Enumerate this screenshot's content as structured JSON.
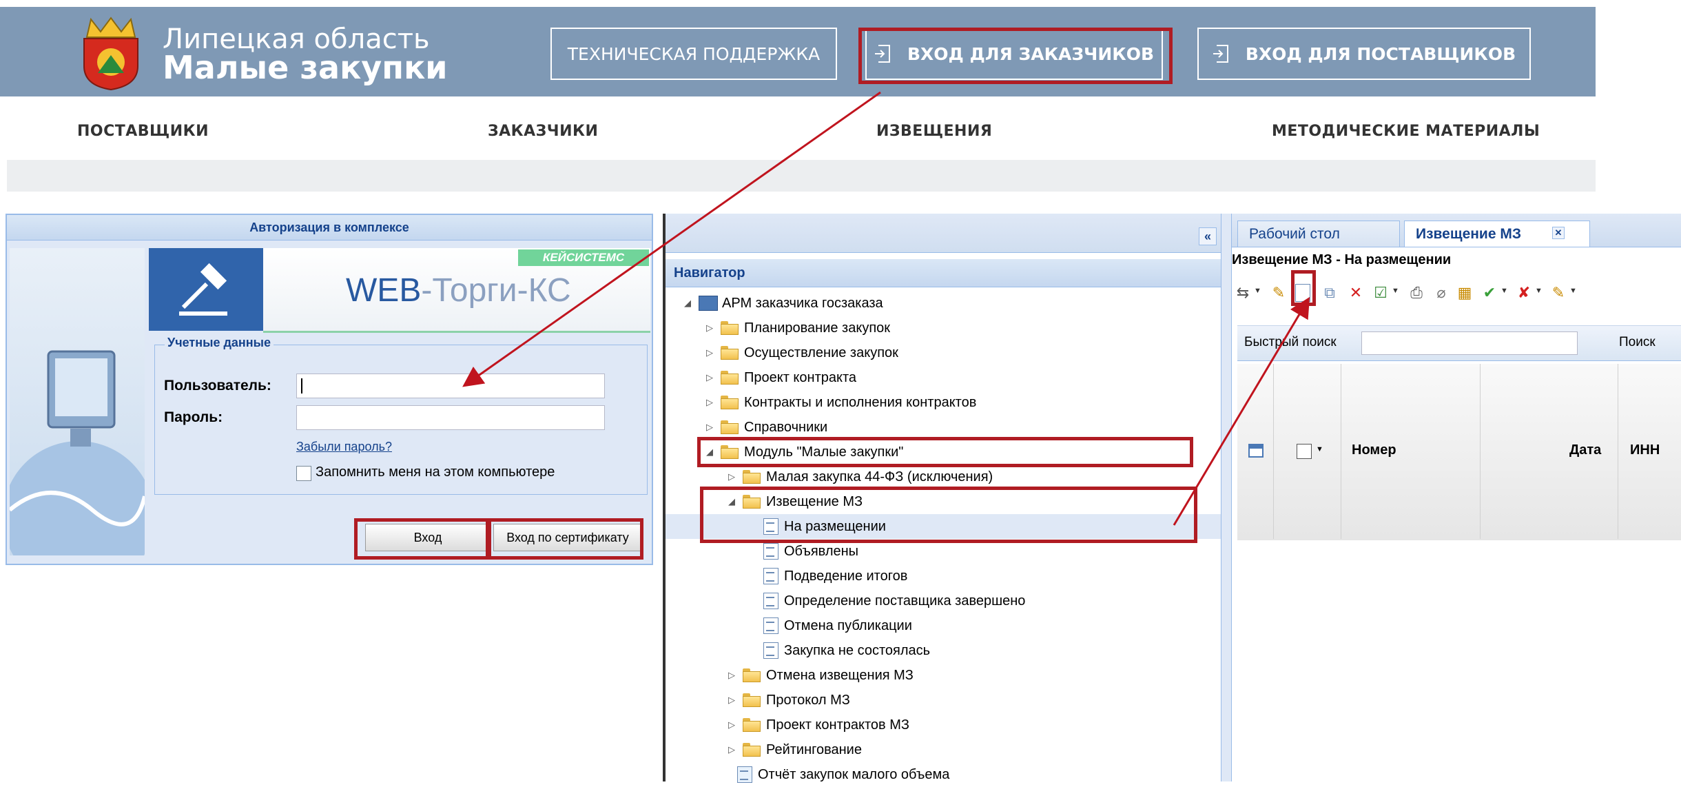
{
  "colors": {
    "header_bg": "#7f99b5",
    "highlight": "#b01c23",
    "arrow": "#c0141e",
    "ext_title": "#15428b"
  },
  "portal": {
    "title_line1": "Липецкая область",
    "title_line2": "Малые закупки",
    "logo_icon": "coat-of-arms-icon",
    "support_btn": "ТЕХНИЧЕСКАЯ ПОДДЕРЖКА",
    "customer_btn": "ВХОД ДЛЯ ЗАКАЗЧИКОВ",
    "supplier_btn": "ВХОД ДЛЯ ПОСТАВЩИКОВ",
    "nav": [
      "ПОСТАВЩИКИ",
      "ЗАКАЗЧИКИ",
      "ИЗВЕЩЕНИЯ",
      "МЕТОДИЧЕСКИЕ МАТЕРИАЛЫ"
    ]
  },
  "login": {
    "header": "Авторизация в комплексе",
    "badge": "КЕЙСИСТЕМС",
    "logo_web": "WEB",
    "logo_rest": "-Торги-КС",
    "legend": "Учетные данные",
    "user_label": "Пользователь:",
    "password_label": "Пароль:",
    "forgot": "Забыли пароль?",
    "remember": "Запомнить меня на этом компьютере",
    "login_btn": "Вход",
    "cert_btn": "Вход по сертификату"
  },
  "navigator": {
    "title": "Навигатор",
    "collapse": "«",
    "items": [
      {
        "label": "АРМ заказчика госзаказа"
      },
      {
        "label": "Планирование закупок"
      },
      {
        "label": "Осуществление закупок"
      },
      {
        "label": "Проект контракта"
      },
      {
        "label": "Контракты и исполнения контрактов"
      },
      {
        "label": "Справочники"
      },
      {
        "label": "Модуль \"Малые закупки\""
      },
      {
        "label": "Малая закупка 44-ФЗ (исключения)"
      },
      {
        "label": "Извещение МЗ"
      },
      {
        "label": "На размещении"
      },
      {
        "label": "Объявлены"
      },
      {
        "label": "Подведение итогов"
      },
      {
        "label": "Определение поставщика завершено"
      },
      {
        "label": "Отмена публикации"
      },
      {
        "label": "Закупка не состоялась"
      },
      {
        "label": "Отмена извещения МЗ"
      },
      {
        "label": "Протокол МЗ"
      },
      {
        "label": "Проект контрактов МЗ"
      },
      {
        "label": "Рейтингование"
      },
      {
        "label": "Отчёт закупок малого объема"
      }
    ]
  },
  "workspace": {
    "tabs": [
      "Рабочий стол",
      "Извещение МЗ"
    ],
    "tab_close": "✕",
    "grid_title": "Извещение МЗ - На размещении",
    "quick_search": "Быстрый поиск",
    "search": "Поиск",
    "columns": [
      "Номер",
      "Дата",
      "ИНН"
    ]
  }
}
